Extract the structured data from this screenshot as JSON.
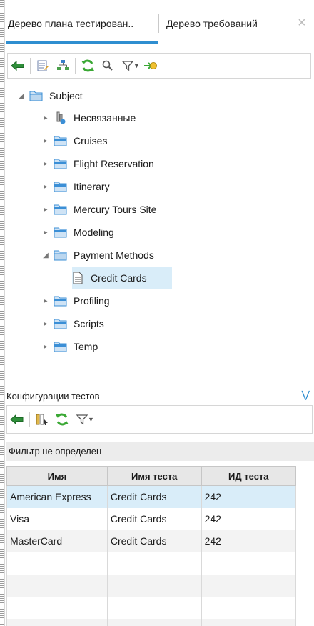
{
  "tabs": [
    {
      "label": "Дерево плана тестирован..",
      "active": true
    },
    {
      "label": "Дерево требований",
      "active": false
    }
  ],
  "tab_close": "×",
  "tree": {
    "root": "Subject",
    "items": [
      {
        "label": "Несвязанные",
        "icon": "unattached-icon"
      },
      {
        "label": "Cruises",
        "icon": "folder-icon"
      },
      {
        "label": "Flight Reservation",
        "icon": "folder-icon"
      },
      {
        "label": "Itinerary",
        "icon": "folder-icon"
      },
      {
        "label": "Mercury Tours Site",
        "icon": "folder-icon"
      },
      {
        "label": "Modeling",
        "icon": "folder-icon"
      },
      {
        "label": "Payment Methods",
        "icon": "folder-open-icon",
        "expanded": true
      },
      {
        "label": "Credit Cards",
        "icon": "test-document-icon",
        "selected": true
      },
      {
        "label": "Profiling",
        "icon": "folder-icon"
      },
      {
        "label": "Scripts",
        "icon": "folder-icon"
      },
      {
        "label": "Temp",
        "icon": "folder-icon"
      }
    ]
  },
  "config": {
    "title": "Конфигурации тестов",
    "filter_text": "Фильтр не определен",
    "columns": [
      "Имя",
      "Имя теста",
      "ИД теста"
    ],
    "rows": [
      [
        "American Express",
        "Credit Cards",
        "242"
      ],
      [
        "Visa",
        "Credit Cards",
        "242"
      ],
      [
        "MasterCard",
        "Credit Cards",
        "242"
      ]
    ]
  },
  "colors": {
    "accent": "#2f8ed0",
    "selection": "#d9edf9",
    "folder": "#3b8fd6",
    "refresh": "#3aa834"
  }
}
